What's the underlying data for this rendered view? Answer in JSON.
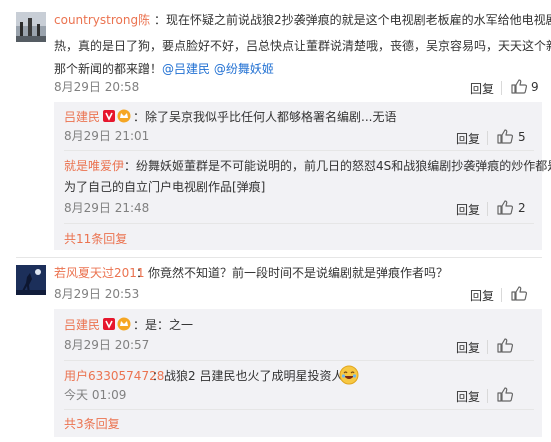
{
  "c1": {
    "user": "countrystrong陈",
    "text_l1": "：现在怀疑之前说战狼2抄袭弹痕的就是这个电视剧老板雇的水军给他电视剧预",
    "text_l2": "热，真的是日了狗，要点脸好不好，吕总快点让董群说清楚哦，丧德，吴京容易吗，天天这个新闻",
    "text_l3a": "那个新闻的都来蹭！",
    "mention1": "@吕建民",
    "mention2": "@纷舞妖姬",
    "time": "8月29日 20:58",
    "reply": "回复",
    "likes": "9"
  },
  "r1": {
    "user": "吕建民",
    "text": "：除了吴京我似乎比任何人都够格署名编剧...无语",
    "time": "8月29日 21:01",
    "reply": "回复",
    "likes": "5"
  },
  "r2": {
    "user": "就是唯爱伊",
    "text_l1": "：纷舞妖姬董群是不可能说明的，前几日的怒怼4S和战狼编剧抄袭弹痕的炒作都是",
    "text_l2": "为了自己的自立门户电视剧作品[弹痕]",
    "time": "8月29日 21:48",
    "reply": "回复",
    "likes": "2"
  },
  "more1": "共11条回复",
  "c2": {
    "user": "若风夏天过2011",
    "text": "：你竟然不知道？前一段时间不是说编剧就是弹痕作者吗？",
    "time": "8月29日 20:53",
    "reply": "回复"
  },
  "r3": {
    "user": "吕建民",
    "text": "：是：之一",
    "time": "8月29日 20:57",
    "reply": "回复"
  },
  "r4": {
    "user": "用户6330574728",
    "text": "：战狼2 吕建民也火了成明星投资人了",
    "time": "今天 01:09",
    "reply": "回复"
  },
  "more2": "共3条回复",
  "colors": {
    "name": "#eb7350",
    "link": "#1f6fd2",
    "reply_bg": "#f2f2f5"
  },
  "icons": [
    "avatar-image",
    "verified-badge",
    "vip-crown-badge",
    "thumbs-up-icon",
    "laughing-emoji"
  ]
}
